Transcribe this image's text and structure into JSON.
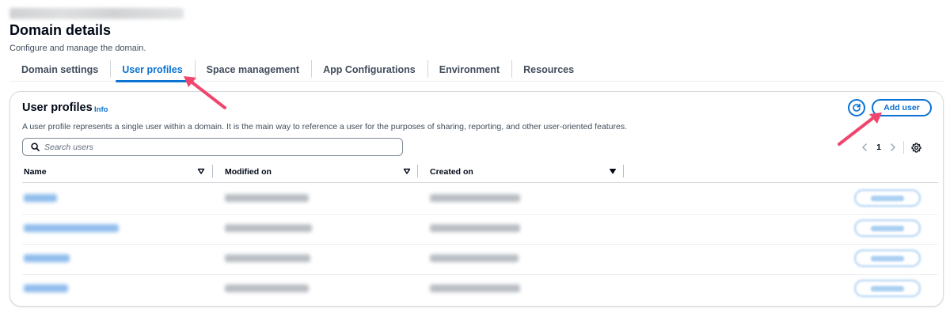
{
  "header": {
    "title": "Domain details",
    "description": "Configure and manage the domain."
  },
  "tabs": [
    {
      "label": "Domain settings",
      "active": false
    },
    {
      "label": "User profiles",
      "active": true
    },
    {
      "label": "Space management",
      "active": false
    },
    {
      "label": "App Configurations",
      "active": false
    },
    {
      "label": "Environment",
      "active": false
    },
    {
      "label": "Resources",
      "active": false
    }
  ],
  "panel": {
    "title": "User profiles",
    "info_label": "Info",
    "description": "A user profile represents a single user within a domain. It is the main way to reference a user for the purposes of sharing, reporting, and other user-oriented features.",
    "add_user_label": "Add user",
    "search_placeholder": "Search users",
    "current_page": "1"
  },
  "table": {
    "columns": [
      "Name",
      "Modified on",
      "Created on"
    ],
    "row_count": 4
  },
  "colors": {
    "accent": "#0972d3",
    "annotation_arrow": "#f0466e"
  },
  "icons": [
    "search-icon",
    "refresh-icon",
    "sort-icon",
    "chevron-left-icon",
    "chevron-right-icon",
    "gear-icon",
    "annotation-arrow"
  ]
}
